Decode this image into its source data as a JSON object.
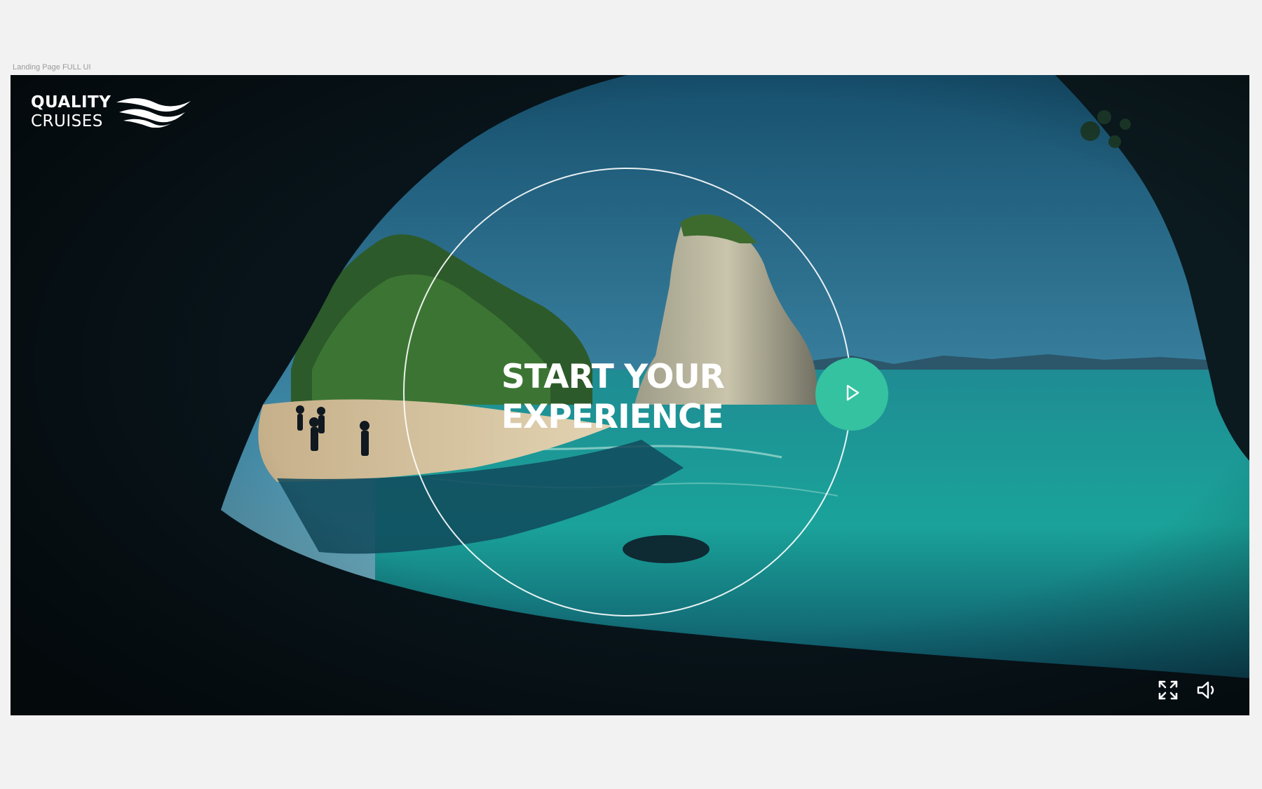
{
  "artboard": {
    "label": "Landing Page FULL UI"
  },
  "brand": {
    "line1": "QUALITY",
    "line2": "CRUISES",
    "logo_icon": "waves-icon"
  },
  "hero": {
    "headline_line1": "START YOUR",
    "headline_line2": "EXPERIENCE",
    "play_icon": "play-icon"
  },
  "controls": {
    "fullscreen_icon": "fullscreen-icon",
    "volume_icon": "volume-icon"
  },
  "colors": {
    "accent": "#35c2a0",
    "text": "#ffffff",
    "background": "#f2f2f2"
  }
}
